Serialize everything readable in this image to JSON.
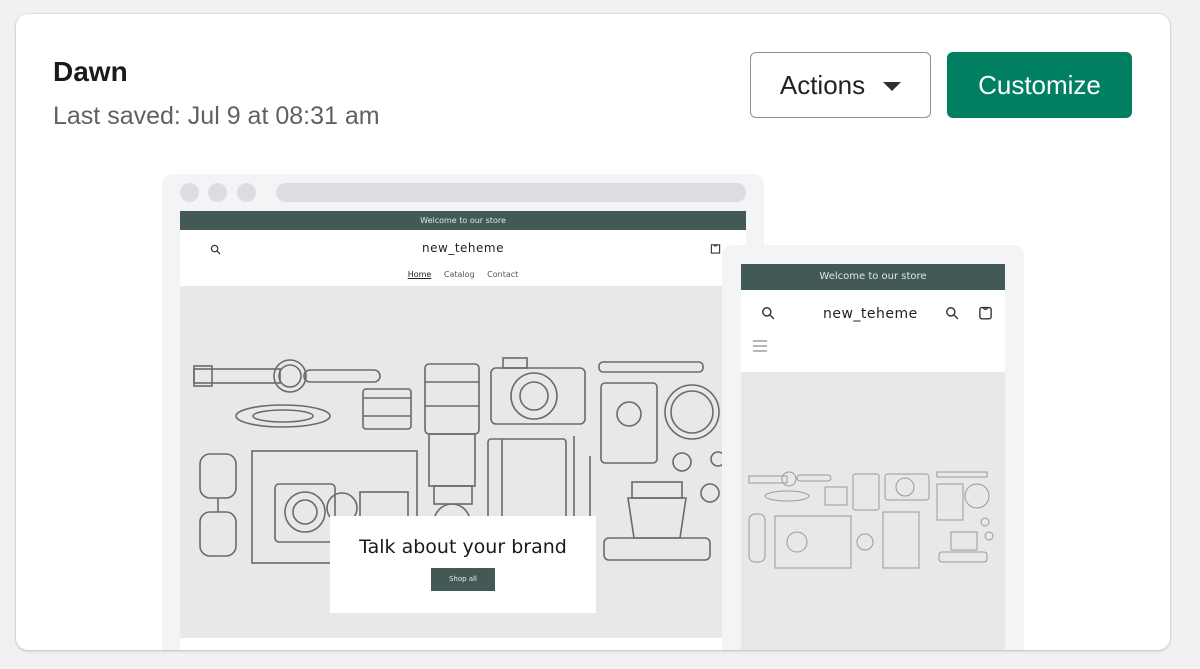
{
  "theme": {
    "name": "Dawn",
    "last_saved": "Last saved: Jul 9 at 08:31 am"
  },
  "buttons": {
    "actions_label": "Actions",
    "customize_label": "Customize"
  },
  "preview": {
    "announcement": "Welcome to our store",
    "store_name": "new_teheme",
    "nav": [
      "Home",
      "Catalog",
      "Contact"
    ],
    "hero_heading": "Talk about your brand",
    "hero_button": "Shop all"
  },
  "colors": {
    "primary_button": "#008060",
    "store_accent": "#435955"
  },
  "icons": [
    "caret-down-icon",
    "search-icon",
    "cart-icon",
    "menu-icon"
  ]
}
